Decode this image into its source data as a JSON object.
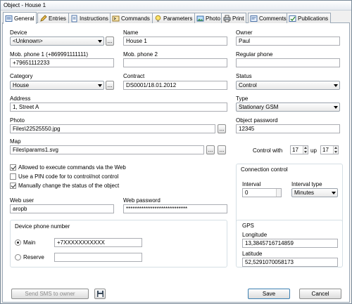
{
  "window": {
    "title": "Object - House 1"
  },
  "tabs": [
    "General",
    "Entries",
    "Instructions",
    "Commands",
    "Parameters",
    "Photo",
    "Print",
    "Comments",
    "Publications"
  ],
  "device": {
    "label": "Device",
    "value": "<Unknown>",
    "browse": "..."
  },
  "name": {
    "label": "Name",
    "value": "House 1"
  },
  "owner": {
    "label": "Owner",
    "value": "Paul"
  },
  "mob_phone1": {
    "label": "Mob. phone 1 (+869991111111)",
    "value": "+79651112233"
  },
  "mob_phone2": {
    "label": "Mob. phone 2",
    "value": ""
  },
  "regular_phone": {
    "label": "Regular phone",
    "value": ""
  },
  "category": {
    "label": "Category",
    "value": "House",
    "browse": "..."
  },
  "contract": {
    "label": "Contract",
    "value": "DS0001/18.01.2012"
  },
  "status": {
    "label": "Status",
    "value": "Control"
  },
  "address": {
    "label": "Address",
    "value": "1, Street A"
  },
  "type": {
    "label": "Type",
    "value": "Stationary GSM"
  },
  "photo": {
    "label": "Photo",
    "value": "Files\\22525550.jpg",
    "browse": "..."
  },
  "object_password": {
    "label": "Object password",
    "value": "12345"
  },
  "map": {
    "label": "Map",
    "value": "Files\\params1.svg",
    "browse1": "...",
    "browse2": "..."
  },
  "control": {
    "label": "Control with",
    "from": "17",
    "up_label": "up",
    "to": "17"
  },
  "checkboxes": [
    {
      "label": "Allowed to execute commands via the Web",
      "checked": true
    },
    {
      "label": "Use a PIN code for to control/not control",
      "checked": false
    },
    {
      "label": "Manually change the status of the object",
      "checked": true
    }
  ],
  "connection_control": {
    "title": "Connection control",
    "interval_label": "Interval",
    "interval_value": "0",
    "interval_type_label": "Interval type",
    "interval_type_value": "Minutes"
  },
  "web_user": {
    "label": "Web user",
    "value": "aropb"
  },
  "web_password": {
    "label": "Web password",
    "value": "****************************"
  },
  "device_phone": {
    "title": "Device phone number",
    "main_label": "Main",
    "main_value": "+7XXXXXXXXXXX",
    "reserve_label": "Reserve",
    "reserve_value": ""
  },
  "gps": {
    "title": "GPS",
    "longitude_label": "Longitude",
    "longitude_value": "13,3845716714859",
    "latitude_label": "Latitude",
    "latitude_value": "52,5291070058173"
  },
  "footer": {
    "send_sms": "Send SMS to owner",
    "save": "Save",
    "cancel": "Cancel"
  }
}
